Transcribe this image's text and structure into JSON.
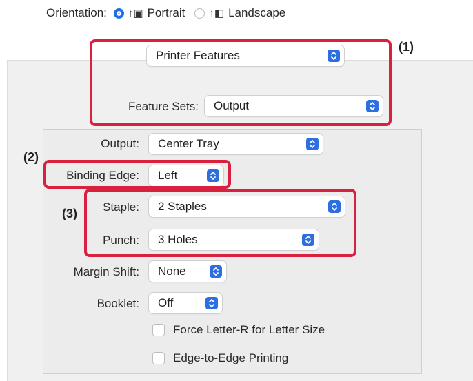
{
  "orientation": {
    "label": "Orientation:",
    "options": [
      {
        "label": "Portrait",
        "selected": true
      },
      {
        "label": "Landscape",
        "selected": false
      }
    ]
  },
  "top_menu": {
    "value": "Printer Features"
  },
  "feature_sets": {
    "label": "Feature Sets:",
    "value": "Output"
  },
  "fields": {
    "output": {
      "label": "Output:",
      "value": "Center Tray"
    },
    "binding_edge": {
      "label": "Binding Edge:",
      "value": "Left"
    },
    "staple": {
      "label": "Staple:",
      "value": "2 Staples"
    },
    "punch": {
      "label": "Punch:",
      "value": "3 Holes"
    },
    "margin_shift": {
      "label": "Margin Shift:",
      "value": "None"
    },
    "booklet": {
      "label": "Booklet:",
      "value": "Off"
    }
  },
  "checkboxes": [
    {
      "label": "Force Letter-R for Letter Size",
      "checked": false
    },
    {
      "label": "Edge-to-Edge Printing",
      "checked": false
    }
  ],
  "callouts": {
    "one": "(1)",
    "two": "(2)",
    "three": "(3)"
  },
  "colors": {
    "accent": "#2d6fe0",
    "callout": "#d9213f"
  }
}
